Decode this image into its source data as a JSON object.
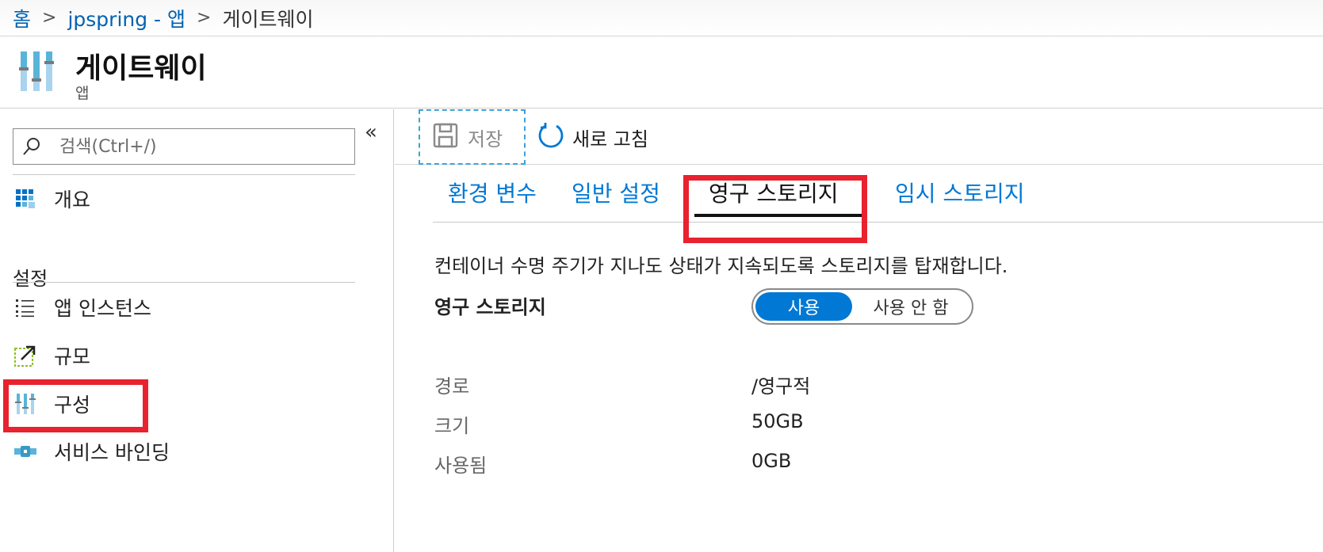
{
  "breadcrumb": {
    "items": [
      "홈",
      "jpspring - 앱",
      "게이트웨이"
    ],
    "separator": ">"
  },
  "header": {
    "title": "게이트웨이",
    "subtitle": "앱",
    "icon": "configuration-sliders-icon"
  },
  "sidebar": {
    "collapse_label": "«",
    "search": {
      "placeholder": "검색(Ctrl+/)",
      "value": ""
    },
    "overview": {
      "label": "개요",
      "icon": "overview-grid-icon"
    },
    "section_title": "설정",
    "items": [
      {
        "label": "앱 인스턴스",
        "icon": "list-icon"
      },
      {
        "label": "규모",
        "icon": "scale-icon"
      },
      {
        "label": "구성",
        "icon": "configuration-sliders-icon",
        "selected": true
      },
      {
        "label": "서비스 바인딩",
        "icon": "service-binding-icon"
      }
    ]
  },
  "toolbar": {
    "save_label": "저장",
    "refresh_label": "새로 고침"
  },
  "tabs": [
    {
      "label": "환경 변수",
      "active": false
    },
    {
      "label": "일반 설정",
      "active": false
    },
    {
      "label": "영구 스토리지",
      "active": true
    },
    {
      "label": "임시 스토리지",
      "active": false
    }
  ],
  "content": {
    "description": "컨테이너 수명 주기가 지나도 상태가 지속되도록 스토리지를 탑재합니다.",
    "persistent_storage_label": "영구 스토리지",
    "toggle": {
      "on_label": "사용",
      "off_label": "사용 안 함",
      "selected": "사용"
    },
    "properties": [
      {
        "label": "경로",
        "value": "/영구적"
      },
      {
        "label": "크기",
        "value": "50GB"
      },
      {
        "label": "사용됨",
        "value": "0GB"
      }
    ]
  },
  "colors": {
    "accent": "#0078d4",
    "link": "#0063b1",
    "highlight": "#e8222f"
  }
}
